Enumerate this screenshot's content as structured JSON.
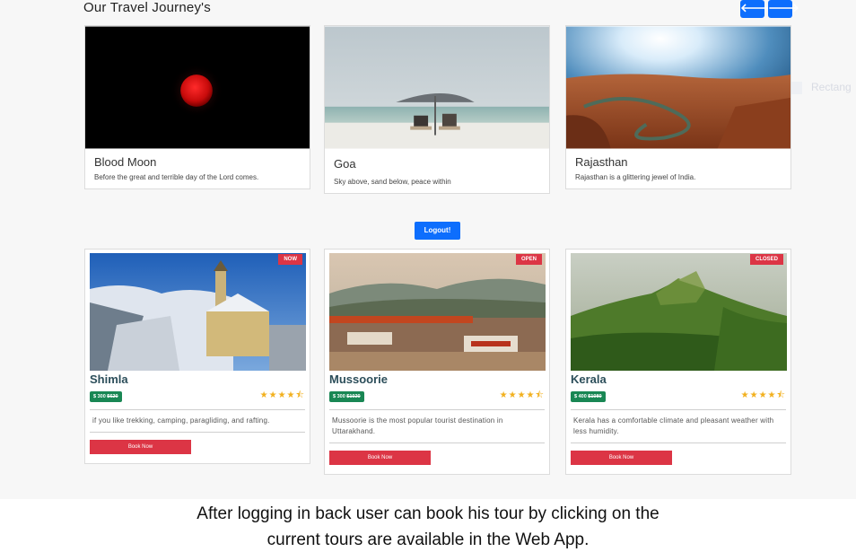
{
  "heading": "Our Travel Journey's",
  "nav": {
    "prev_icon": "arrow-left-icon",
    "next_icon": "arrow-right-icon",
    "prev_glyph": "🡐",
    "next_glyph": "🡒"
  },
  "ghost_label": "Rectang",
  "journeys": [
    {
      "title": "Blood Moon",
      "desc": "Before the great and terrible day of the Lord comes."
    },
    {
      "title": "Goa",
      "desc": "Sky above, sand below, peace within"
    },
    {
      "title": "Rajasthan",
      "desc": "Rajasthan is a glittering jewel of India."
    }
  ],
  "logout_label": "Logout!",
  "tours": [
    {
      "badge": "NOW",
      "name": "Shimla",
      "price_now": "$ 300",
      "price_old": "$620",
      "stars": "★★★★⯪",
      "desc": "if you like trekking, camping, paragliding, and rafting.",
      "book_label": "Book Now"
    },
    {
      "badge": "OPEN",
      "name": "Mussoorie",
      "price_now": "$ 300",
      "price_old": "$1020",
      "stars": "★★★★⯪",
      "desc": "Mussoorie is the most popular tourist destination in Uttarakhand.",
      "book_label": "Book Now"
    },
    {
      "badge": "CLOSED",
      "name": "Kerala",
      "price_now": "$ 400",
      "price_old": "$1080",
      "stars": "★★★★⯪",
      "desc": "Kerala has a comfortable climate and pleasant weather with less humidity.",
      "book_label": "Book Now"
    }
  ],
  "caption": {
    "line1": "After logging in back user can book his tour by clicking on the",
    "line2": "current tours are available in the Web App."
  },
  "colors": {
    "primary": "#0d6efd",
    "danger": "#dc3545",
    "success": "#198754",
    "star": "#f2b01e"
  }
}
